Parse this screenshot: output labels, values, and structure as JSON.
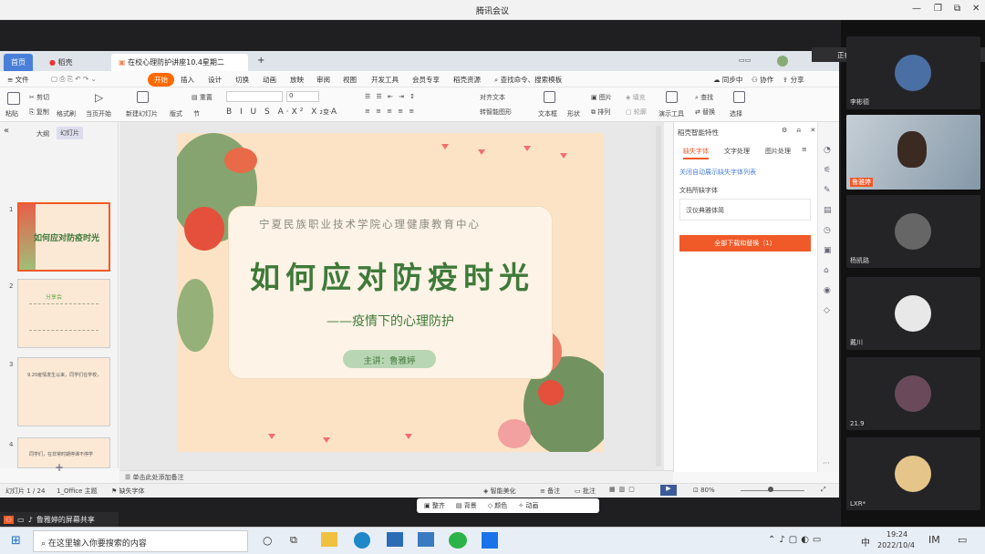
{
  "window": {
    "title": "腾讯会议"
  },
  "tabs": {
    "home": "首页",
    "docer": "稻壳",
    "doc": "在校心理防护讲座10.4星期二",
    "add": "+"
  },
  "menu": {
    "file": "文件",
    "start": "开始",
    "insert": "插入",
    "design": "设计",
    "switch": "切换",
    "animation": "动画",
    "show": "放映",
    "review": "审阅",
    "view": "视图",
    "dev": "开发工具",
    "member": "会员专享",
    "docer_res": "稻壳资源",
    "search": "查找命令、搜索模板",
    "sync": "同步中",
    "coop": "协作",
    "share": "分享"
  },
  "ribbon": {
    "paste": "粘贴",
    "cut": "剪切",
    "copy": "复制",
    "format": "格式刷",
    "from_current": "当页开始",
    "new_slide": "新建幻灯片",
    "layout": "版式",
    "section": "节",
    "reset": "重置",
    "font_size": "0",
    "textbox": "文本框",
    "shape": "形状",
    "picture": "图片",
    "arrange": "排列",
    "fill": "填充",
    "outline": "轮廓",
    "play_tools": "演示工具",
    "find": "查找",
    "replace": "替换",
    "select": "选择",
    "to_smart": "转智能图形",
    "text_dir": "对齐文本"
  },
  "thumbs": {
    "outline": "大纲",
    "slides": "幻灯片",
    "n1": "1",
    "n2": "2",
    "n3": "3",
    "n4": "4",
    "t1": "如何应对防疫时光",
    "t2": "分享会",
    "t3": "9.20疫情发生以来，同学们在学校，",
    "t4": "同学们，在非常时期停课不停学"
  },
  "slide": {
    "org": "宁夏民族职业技术学院心理健康教育中心",
    "title": "如何应对防疫时光",
    "subtitle": "——疫情下的心理防护",
    "speaker": "主讲：鲁雅婷"
  },
  "slide_toolbar": {
    "bg": "背景",
    "color": "颜色",
    "anim": "动画",
    "arrange": "整齐"
  },
  "smart": {
    "header": "稻壳智能特性",
    "tab1": "缺失字体",
    "tab2": "文字处理",
    "tab3": "图片处理",
    "link": "关闭自动展示缺失字体列表",
    "doc_missing": "文档所缺字体",
    "font": "汉仪典雅体简",
    "btn": "全部下载和替换（1）"
  },
  "notes": {
    "placeholder": "单击此处添加备注"
  },
  "status": {
    "slide": "幻灯片 1 / 24",
    "theme": "1_Office 主题",
    "missing": "缺失字体",
    "beautify": "智能美化",
    "notes": "备注",
    "comment": "批注",
    "zoom": "80%"
  },
  "meeting": {
    "speaking_label": "正在讲话:",
    "share": "鲁雅婷的屏幕共享",
    "participants": [
      "李彬德",
      "鲁雅婷",
      "杨凯路",
      "戴川",
      "21.9",
      "LXR*"
    ]
  },
  "taskbar": {
    "search": "在这里输入你要搜索的内容",
    "time": "19:24",
    "date": "2022/10/4",
    "ime": "中"
  },
  "colors": {
    "accent": "#f05a28",
    "wps_orange": "#ff6a00",
    "slide_green": "#3f7a3a"
  }
}
